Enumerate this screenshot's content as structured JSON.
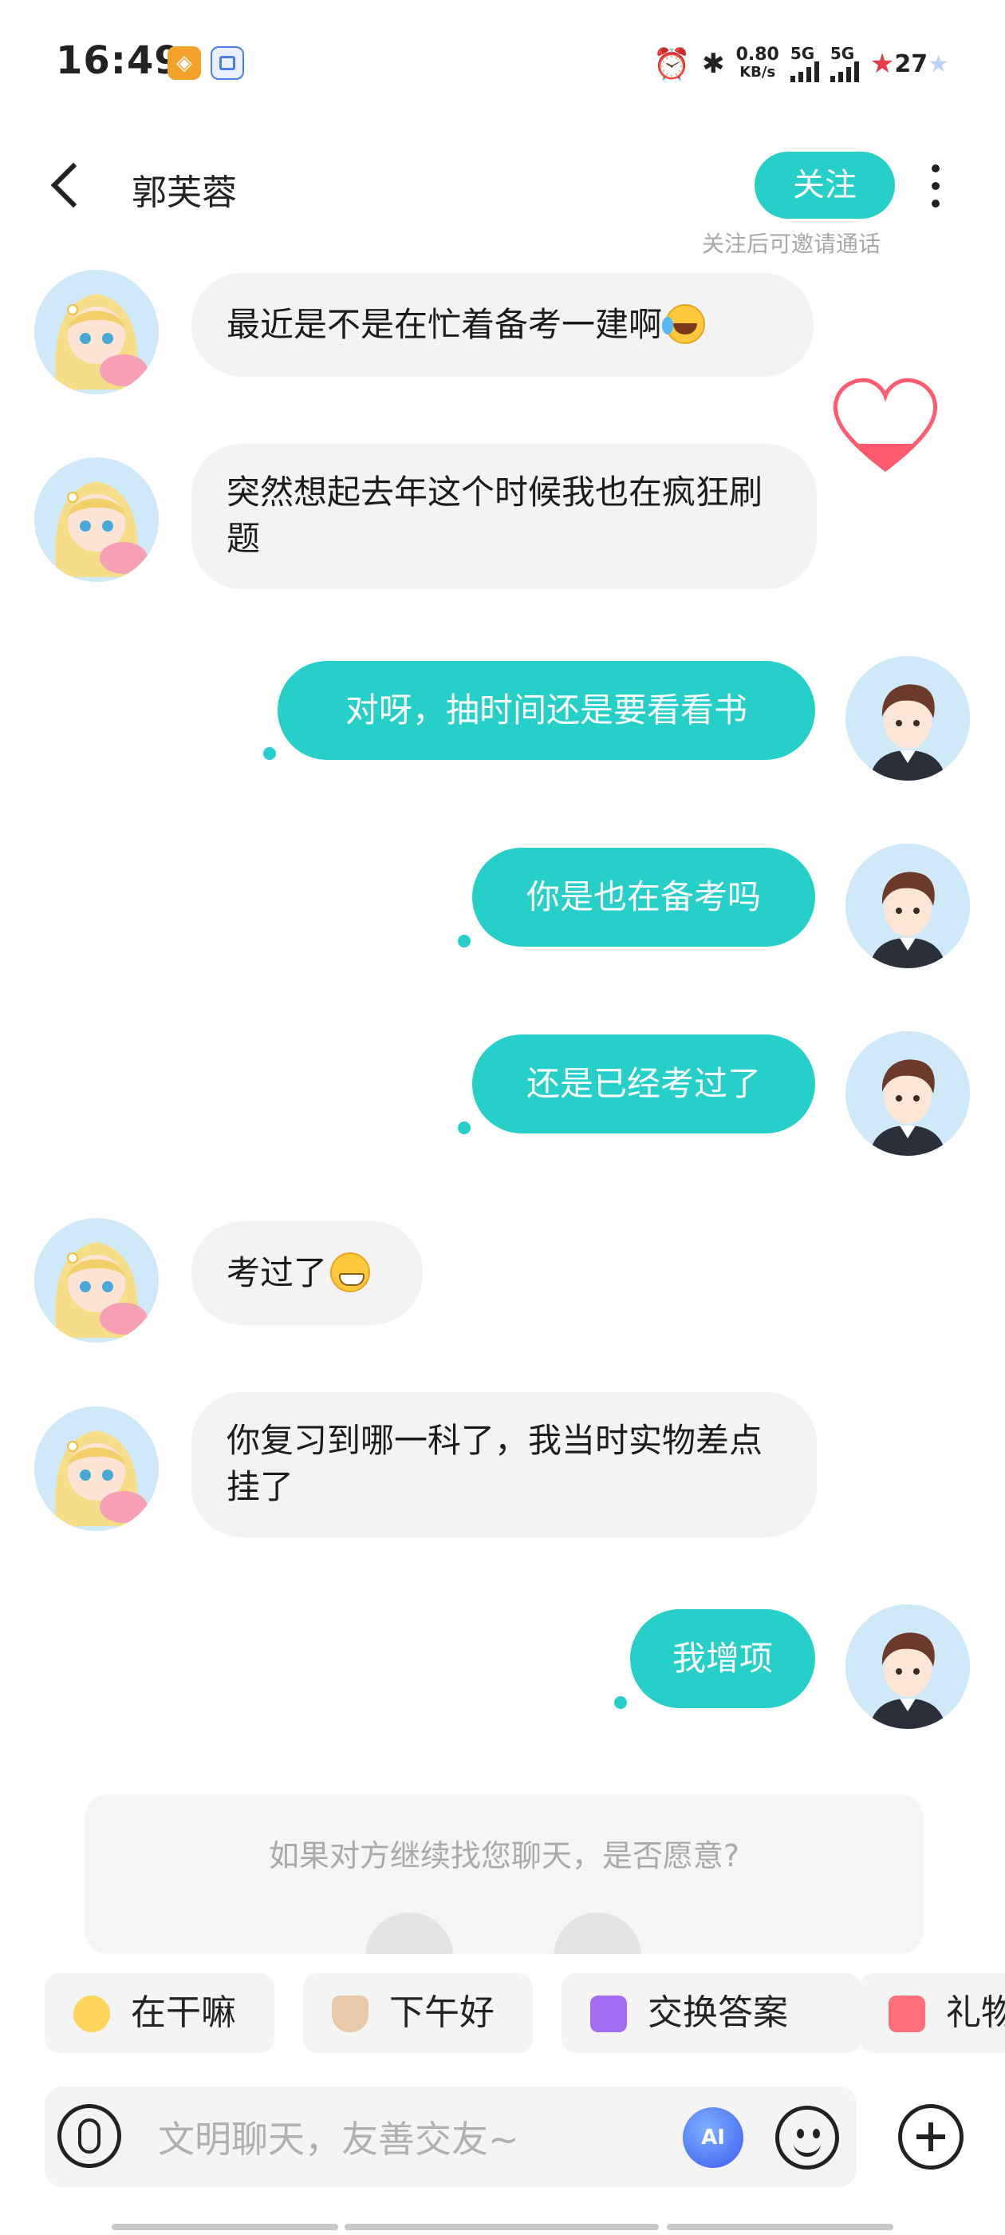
{
  "status_bar": {
    "time": "16:49",
    "net_speed_value": "0.80",
    "net_speed_unit": "KB/s",
    "sim1": "5G",
    "sim2": "5G",
    "battery": "27",
    "icons": [
      "app-orange-icon",
      "app-blue-icon",
      "alarm-icon",
      "bluetooth-icon",
      "signal-icon",
      "battery-icon"
    ]
  },
  "header": {
    "contact_name": "郭芙蓉",
    "follow_label": "关注",
    "follow_hint": "关注后可邀请通话"
  },
  "messages": [
    {
      "side": "in",
      "text": "最近是不是在忙着备考一建啊",
      "emoji": "crying-laughing-emoji"
    },
    {
      "side": "in",
      "text": "突然想起去年这个时候我也在疯狂刷题"
    },
    {
      "side": "out",
      "text": "对呀，抽时间还是要看看书"
    },
    {
      "side": "out",
      "text": "你是也在备考吗"
    },
    {
      "side": "out",
      "text": "还是已经考过了"
    },
    {
      "side": "in",
      "text": "考过了",
      "emoji": "grinning-emoji"
    },
    {
      "side": "in",
      "text": "你复习到哪一科了，我当时实物差点挂了"
    },
    {
      "side": "out",
      "text": "我增项"
    }
  ],
  "prompt_card": {
    "question": "如果对方继续找您聊天，是否愿意?"
  },
  "quick_replies": [
    {
      "label": "在干嘛",
      "icon": "thinking-emoji-icon"
    },
    {
      "label": "下午好",
      "icon": "coffee-icon"
    },
    {
      "label": "交换答案",
      "icon": "exchange-icon"
    },
    {
      "label": "礼物",
      "icon": "gift-icon"
    }
  ],
  "input": {
    "placeholder": "文明聊天，友善交友~",
    "ai_label": "AI"
  },
  "colors": {
    "accent": "#26cfc8",
    "incoming_bubble": "#f3f3f3",
    "hint_text": "#a8a8a8"
  }
}
